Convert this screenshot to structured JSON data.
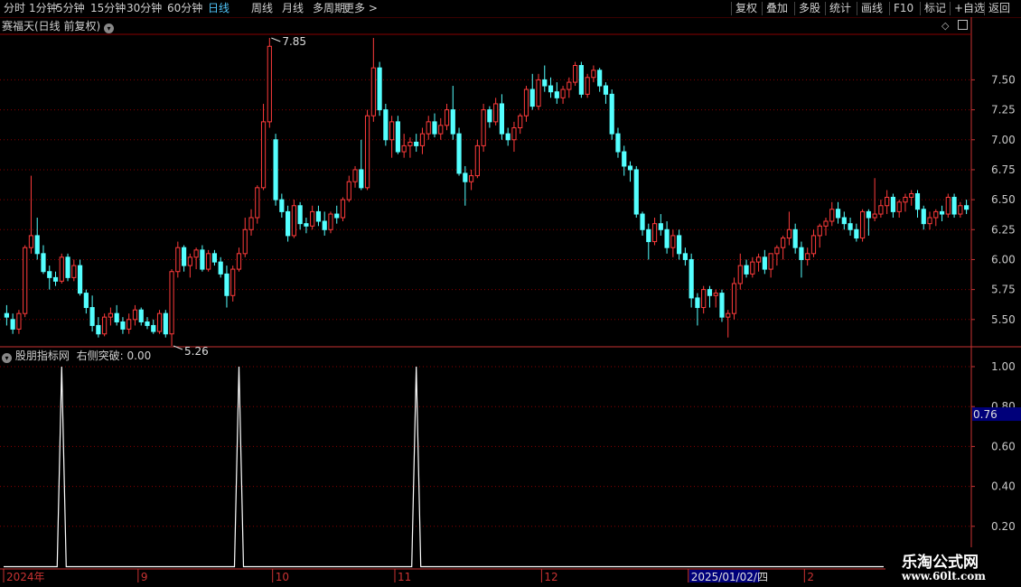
{
  "toolbar": {
    "left": [
      "分时",
      "1分钟",
      "5分钟",
      "15分钟",
      "30分钟",
      "60分钟",
      "日线",
      "周线",
      "月线",
      "多周期",
      "更多 >"
    ],
    "active": "日线",
    "right": [
      "复权",
      "叠加",
      "多股",
      "统计",
      "画线",
      "F10",
      "标记",
      "+自选",
      "返回"
    ]
  },
  "main_title": "赛福天(日线 前复权)",
  "indicator_title": "股朋指标网",
  "indicator_value": "右侧突破: 0.00",
  "colors": {
    "up": "#ff3b3b",
    "down": "#54ffff",
    "grid": "#8a0000",
    "axis": "#c83232",
    "line": "#ffffff"
  },
  "watermark": {
    "name": "乐淘公式网",
    "url": "www.60lt.com"
  },
  "chart_data": [
    {
      "type": "candlestick",
      "ylim": [
        5.28,
        7.88
      ],
      "yticks": [
        "7.50",
        "7.25",
        "7.00",
        "6.75",
        "6.50",
        "6.25",
        "6.00",
        "5.75",
        "5.50"
      ],
      "annotations": [
        "7.85",
        "5.26"
      ],
      "candles": [
        [
          5.55,
          5.62,
          5.45,
          5.52
        ],
        [
          5.5,
          5.55,
          5.38,
          5.42
        ],
        [
          5.42,
          5.58,
          5.38,
          5.55
        ],
        [
          5.55,
          6.12,
          5.52,
          6.1
        ],
        [
          6.1,
          6.7,
          6.05,
          6.2
        ],
        [
          6.2,
          6.35,
          6.0,
          6.05
        ],
        [
          6.05,
          6.12,
          5.88,
          5.9
        ],
        [
          5.9,
          5.95,
          5.75,
          5.85
        ],
        [
          5.85,
          5.9,
          5.78,
          5.82
        ],
        [
          5.82,
          6.05,
          5.8,
          6.02
        ],
        [
          6.02,
          6.05,
          5.82,
          5.85
        ],
        [
          5.85,
          6.0,
          5.82,
          5.95
        ],
        [
          5.95,
          6.0,
          5.7,
          5.72
        ],
        [
          5.72,
          5.75,
          5.55,
          5.6
        ],
        [
          5.6,
          5.7,
          5.4,
          5.45
        ],
        [
          5.45,
          5.52,
          5.35,
          5.38
        ],
        [
          5.38,
          5.55,
          5.36,
          5.52
        ],
        [
          5.52,
          5.6,
          5.45,
          5.55
        ],
        [
          5.55,
          5.62,
          5.45,
          5.48
        ],
        [
          5.48,
          5.52,
          5.38,
          5.42
        ],
        [
          5.42,
          5.55,
          5.38,
          5.5
        ],
        [
          5.5,
          5.62,
          5.45,
          5.58
        ],
        [
          5.58,
          5.6,
          5.45,
          5.48
        ],
        [
          5.48,
          5.52,
          5.42,
          5.45
        ],
        [
          5.45,
          5.5,
          5.38,
          5.4
        ],
        [
          5.4,
          5.58,
          5.38,
          5.55
        ],
        [
          5.55,
          5.58,
          5.35,
          5.38
        ],
        [
          5.38,
          5.92,
          5.28,
          5.9
        ],
        [
          5.9,
          6.15,
          5.85,
          6.1
        ],
        [
          6.1,
          6.12,
          5.9,
          5.95
        ],
        [
          5.95,
          6.05,
          5.85,
          6.02
        ],
        [
          6.02,
          6.1,
          5.92,
          6.08
        ],
        [
          6.08,
          6.12,
          5.9,
          5.92
        ],
        [
          5.92,
          6.08,
          5.9,
          6.05
        ],
        [
          6.05,
          6.08,
          5.95,
          5.98
        ],
        [
          5.98,
          6.02,
          5.85,
          5.88
        ],
        [
          5.88,
          5.95,
          5.6,
          5.7
        ],
        [
          5.7,
          5.95,
          5.65,
          5.92
        ],
        [
          5.92,
          6.1,
          5.9,
          6.05
        ],
        [
          6.05,
          6.35,
          6.02,
          6.25
        ],
        [
          6.25,
          6.42,
          6.2,
          6.35
        ],
        [
          6.35,
          6.62,
          6.3,
          6.6
        ],
        [
          6.6,
          7.3,
          6.58,
          7.15
        ],
        [
          7.15,
          7.85,
          7.1,
          7.78
        ],
        [
          7.0,
          7.05,
          6.45,
          6.5
        ],
        [
          6.5,
          6.55,
          6.35,
          6.4
        ],
        [
          6.4,
          6.45,
          6.15,
          6.2
        ],
        [
          6.2,
          6.5,
          6.18,
          6.45
        ],
        [
          6.45,
          6.48,
          6.25,
          6.3
        ],
        [
          6.3,
          6.35,
          6.22,
          6.28
        ],
        [
          6.28,
          6.45,
          6.25,
          6.4
        ],
        [
          6.4,
          6.45,
          6.28,
          6.32
        ],
        [
          6.32,
          6.4,
          6.2,
          6.25
        ],
        [
          6.25,
          6.4,
          6.22,
          6.38
        ],
        [
          6.38,
          6.45,
          6.3,
          6.35
        ],
        [
          6.35,
          6.52,
          6.32,
          6.5
        ],
        [
          6.5,
          6.7,
          6.48,
          6.65
        ],
        [
          6.65,
          6.78,
          6.6,
          6.75
        ],
        [
          6.75,
          7.0,
          6.58,
          6.6
        ],
        [
          6.6,
          7.25,
          6.58,
          7.2
        ],
        [
          7.2,
          7.85,
          7.15,
          7.6
        ],
        [
          7.6,
          7.65,
          7.2,
          7.25
        ],
        [
          7.25,
          7.3,
          6.95,
          7.0
        ],
        [
          7.0,
          7.2,
          6.85,
          7.15
        ],
        [
          7.15,
          7.2,
          6.88,
          6.9
        ],
        [
          6.9,
          7.05,
          6.85,
          6.95
        ],
        [
          6.95,
          7.02,
          6.85,
          6.98
        ],
        [
          6.98,
          7.05,
          6.9,
          6.95
        ],
        [
          6.95,
          7.1,
          6.88,
          7.05
        ],
        [
          7.05,
          7.2,
          7.0,
          7.15
        ],
        [
          7.15,
          7.22,
          7.02,
          7.05
        ],
        [
          7.05,
          7.18,
          7.0,
          7.12
        ],
        [
          7.12,
          7.3,
          7.08,
          7.25
        ],
        [
          7.25,
          7.45,
          7.0,
          7.05
        ],
        [
          7.05,
          7.1,
          6.7,
          6.72
        ],
        [
          6.72,
          6.78,
          6.45,
          6.65
        ],
        [
          6.65,
          6.75,
          6.58,
          6.7
        ],
        [
          6.7,
          7.0,
          6.68,
          6.95
        ],
        [
          6.95,
          7.3,
          6.9,
          7.25
        ],
        [
          7.25,
          7.28,
          7.1,
          7.15
        ],
        [
          7.15,
          7.35,
          7.12,
          7.3
        ],
        [
          7.3,
          7.38,
          7.0,
          7.05
        ],
        [
          7.05,
          7.1,
          6.95,
          7.0
        ],
        [
          7.0,
          7.15,
          6.9,
          7.1
        ],
        [
          7.1,
          7.22,
          7.05,
          7.2
        ],
        [
          7.2,
          7.45,
          7.15,
          7.42
        ],
        [
          7.42,
          7.55,
          7.25,
          7.28
        ],
        [
          7.28,
          7.55,
          7.25,
          7.5
        ],
        [
          7.5,
          7.62,
          7.4,
          7.45
        ],
        [
          7.45,
          7.52,
          7.35,
          7.4
        ],
        [
          7.4,
          7.48,
          7.3,
          7.35
        ],
        [
          7.35,
          7.45,
          7.3,
          7.42
        ],
        [
          7.42,
          7.52,
          7.35,
          7.48
        ],
        [
          7.48,
          7.65,
          7.45,
          7.62
        ],
        [
          7.62,
          7.65,
          7.35,
          7.38
        ],
        [
          7.38,
          7.55,
          7.35,
          7.52
        ],
        [
          7.52,
          7.62,
          7.48,
          7.58
        ],
        [
          7.58,
          7.6,
          7.4,
          7.45
        ],
        [
          7.45,
          7.48,
          7.3,
          7.38
        ],
        [
          7.38,
          7.42,
          7.0,
          7.05
        ],
        [
          7.05,
          7.1,
          6.85,
          6.9
        ],
        [
          6.9,
          6.95,
          6.7,
          6.78
        ],
        [
          6.78,
          6.82,
          6.65,
          6.75
        ],
        [
          6.75,
          6.78,
          6.35,
          6.38
        ],
        [
          6.38,
          6.4,
          6.2,
          6.25
        ],
        [
          6.25,
          6.3,
          6.0,
          6.15
        ],
        [
          6.15,
          6.35,
          6.12,
          6.3
        ],
        [
          6.3,
          6.38,
          6.2,
          6.25
        ],
        [
          6.25,
          6.32,
          6.05,
          6.1
        ],
        [
          6.1,
          6.25,
          6.02,
          6.2
        ],
        [
          6.2,
          6.25,
          6.0,
          6.05
        ],
        [
          6.05,
          6.1,
          5.95,
          6.0
        ],
        [
          6.0,
          6.05,
          5.6,
          5.68
        ],
        [
          5.68,
          5.72,
          5.45,
          5.6
        ],
        [
          5.6,
          5.78,
          5.55,
          5.75
        ],
        [
          5.75,
          5.78,
          5.6,
          5.7
        ],
        [
          5.7,
          5.75,
          5.6,
          5.72
        ],
        [
          5.72,
          5.75,
          5.48,
          5.52
        ],
        [
          5.52,
          5.58,
          5.35,
          5.55
        ],
        [
          5.55,
          5.85,
          5.5,
          5.8
        ],
        [
          5.8,
          6.05,
          5.75,
          5.95
        ],
        [
          5.95,
          6.0,
          5.85,
          5.88
        ],
        [
          5.88,
          6.02,
          5.85,
          5.98
        ],
        [
          5.98,
          6.05,
          5.9,
          6.02
        ],
        [
          6.02,
          6.08,
          5.88,
          5.92
        ],
        [
          5.92,
          6.05,
          5.85,
          6.05
        ],
        [
          6.05,
          6.12,
          5.95,
          6.1
        ],
        [
          6.1,
          6.2,
          6.0,
          6.18
        ],
        [
          6.18,
          6.4,
          6.12,
          6.25
        ],
        [
          6.25,
          6.3,
          6.05,
          6.1
        ],
        [
          6.1,
          6.15,
          5.85,
          6.0
        ],
        [
          6.0,
          6.1,
          5.95,
          6.05
        ],
        [
          6.05,
          6.25,
          6.02,
          6.2
        ],
        [
          6.2,
          6.3,
          6.1,
          6.28
        ],
        [
          6.28,
          6.35,
          6.2,
          6.32
        ],
        [
          6.32,
          6.48,
          6.28,
          6.42
        ],
        [
          6.42,
          6.48,
          6.3,
          6.35
        ],
        [
          6.35,
          6.4,
          6.25,
          6.3
        ],
        [
          6.3,
          6.35,
          6.2,
          6.25
        ],
        [
          6.25,
          6.3,
          6.15,
          6.18
        ],
        [
          6.18,
          6.42,
          6.15,
          6.4
        ],
        [
          6.4,
          6.42,
          6.2,
          6.35
        ],
        [
          6.35,
          6.68,
          6.32,
          6.38
        ],
        [
          6.38,
          6.5,
          6.35,
          6.45
        ],
        [
          6.45,
          6.58,
          6.38,
          6.52
        ],
        [
          6.52,
          6.55,
          6.35,
          6.4
        ],
        [
          6.4,
          6.5,
          6.35,
          6.48
        ],
        [
          6.48,
          6.55,
          6.4,
          6.52
        ],
        [
          6.52,
          6.58,
          6.45,
          6.55
        ],
        [
          6.55,
          6.58,
          6.35,
          6.42
        ],
        [
          6.42,
          6.45,
          6.25,
          6.3
        ],
        [
          6.3,
          6.4,
          6.25,
          6.35
        ],
        [
          6.35,
          6.42,
          6.28,
          6.4
        ],
        [
          6.4,
          6.45,
          6.32,
          6.38
        ],
        [
          6.38,
          6.55,
          6.35,
          6.52
        ],
        [
          6.52,
          6.55,
          6.35,
          6.38
        ],
        [
          6.38,
          6.48,
          6.35,
          6.45
        ],
        [
          6.45,
          6.5,
          6.38,
          6.42
        ]
      ]
    },
    {
      "type": "line",
      "ylim": [
        0.0,
        1.0
      ],
      "yticks": [
        "1.00",
        "0.80",
        "0.60",
        "0.40",
        "0.20"
      ],
      "current_value": "0.76",
      "spike_indices": [
        9,
        38,
        67
      ],
      "series": [
        {
          "values_note_free": true
        }
      ]
    }
  ],
  "xaxis": {
    "labels": [
      "2024年",
      "9",
      "10",
      "11",
      "12",
      "2025/01/02/四",
      "2"
    ],
    "label_indices": [
      0,
      22,
      44,
      64,
      88,
      112,
      131
    ],
    "highlight": "2025/01/02/四"
  }
}
